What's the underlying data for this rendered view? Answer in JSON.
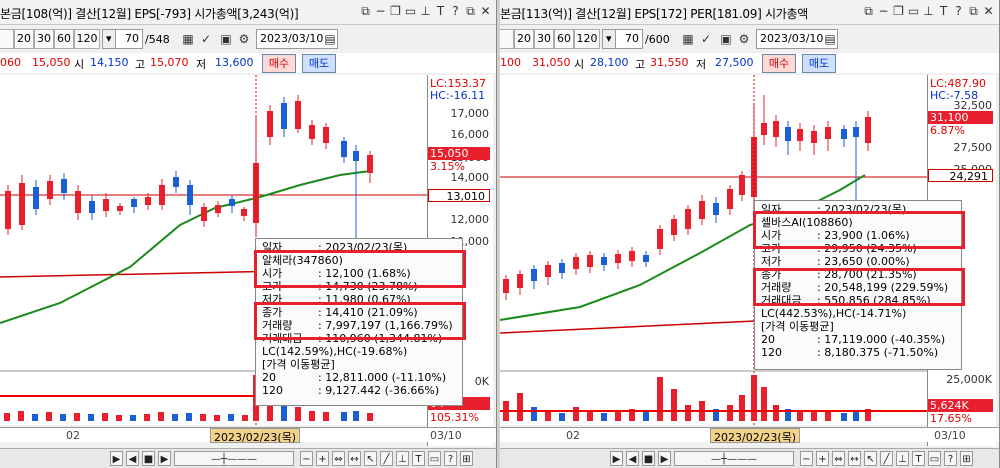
{
  "colors": {
    "up": "#e8202e",
    "down": "#1b5fd6",
    "ma": "#1a8a1a",
    "line": "#cc0000",
    "highlight": "#e8202e"
  },
  "left": {
    "title": "본금[108(억)] 결산[12월] EPS[-793] 시가총액[3,243(억)]",
    "title_icons": [
      "restore-icon",
      "unpin-icon",
      "copy-icon",
      "minimize-icon",
      "pin-icon",
      "text-icon",
      "help-icon",
      "restore-icon",
      "close-icon"
    ],
    "period_buttons": [
      "20",
      "30",
      "60",
      "120"
    ],
    "count_value": "70",
    "count_total": "/548",
    "date_value": "2023/03/10",
    "prev_close": "060",
    "current": "15,050",
    "open_label": "시",
    "open": "14,150",
    "high_label": "고",
    "high": "15,070",
    "low_label": "저",
    "low": "13,600",
    "buy": "매수",
    "sell": "매도",
    "axis": {
      "lc": "LC:153.37",
      "hc": "HC:-16.11",
      "ticks": [
        "17,000",
        "16,000",
        "15,000",
        "14,000",
        "13,000",
        "12,000",
        "11,000"
      ],
      "price_flag": "15,050",
      "pct_flag": "3.15%",
      "line_flag": "13,010",
      "vol_tick": "0K",
      "vol_flag": "04",
      "vol_pct": "105.31%"
    },
    "dates": {
      "d1": "02",
      "highlight": "2023/02/23(목)",
      "end": "03/10"
    },
    "tooltip": {
      "date_label": "일자",
      "date_value": ": 2023/02/23(목)",
      "name": "알체라(347860)",
      "rows": [
        {
          "k": "시가",
          "v": ": 12,100 (1.68%)"
        },
        {
          "k": "고가",
          "v": ": 14,730 (23.78%)"
        },
        {
          "k": "저가",
          "v": ": 11,980 (0.67%)"
        },
        {
          "k": "종가",
          "v": ": 14,410 (21.09%)"
        },
        {
          "k": "거래량",
          "v": ": 7,997,197 (1,166.79%)"
        },
        {
          "k": "거래대금",
          "v": ": 110,960 (1,344.81%)"
        }
      ],
      "lc_hc": "LC(142.59%),HC(-19.68%)",
      "ma_header": "[가격 이동평균]",
      "ma_rows": [
        {
          "k": "20",
          "v": ": 12,811.000 (-11.10%)"
        },
        {
          "k": "120",
          "v": ": 9,127.442 (-36.66%)"
        }
      ]
    }
  },
  "right": {
    "title": "본금[113(억)] 결산[12월] EPS[172] PER[181.09] 시가총액",
    "title_icons": [
      "restore-icon",
      "unpin-icon",
      "copy-icon",
      "minimize-icon",
      "pin-icon",
      "text-icon",
      "help-icon",
      "restore-icon",
      "close-icon"
    ],
    "period_buttons": [
      "20",
      "30",
      "60",
      "120"
    ],
    "count_value": "70",
    "count_total": "/600",
    "date_value": "2023/03/10",
    "prev_close": "100",
    "current": "31,050",
    "open_label": "시",
    "open": "28,100",
    "high_label": "고",
    "high": "31,550",
    "low_label": "저",
    "low": "27,500",
    "buy": "매수",
    "sell": "매도",
    "axis": {
      "lc": "LC:487.90",
      "hc": "HC:-7.58",
      "ticks": [
        "32,500",
        "30,000",
        "27,500",
        "25,000"
      ],
      "price_flag": "31,100",
      "pct_flag": "6.87%",
      "line_flag": "24,291",
      "vol_tick": "25,000K",
      "vol_flag": "5,624K",
      "vol_pct": "17.65%"
    },
    "dates": {
      "d1": "02",
      "highlight": "2023/02/23(목)",
      "end": "03/10"
    },
    "tooltip": {
      "date_label": "일자",
      "date_value": ": 2023/02/23(목)",
      "name": "셀바스AI(108860)",
      "rows": [
        {
          "k": "시가",
          "v": ": 23,900 (1.06%)"
        },
        {
          "k": "고가",
          "v": ": 29,950 (24.35%)"
        },
        {
          "k": "저가",
          "v": ": 23,650 (0.00%)"
        },
        {
          "k": "종가",
          "v": ": 28,700 (21.35%)"
        },
        {
          "k": "거래량",
          "v": ": 20,548,199 (229.59%)"
        },
        {
          "k": "거래대금",
          "v": ": 550,856 (284.85%)"
        }
      ],
      "lc_hc": "LC(442.53%),HC(-14.71%)",
      "ma_header": "[가격 이동평균]",
      "ma_rows": [
        {
          "k": "20",
          "v": ": 17,119.000 (-40.35%)"
        },
        {
          "k": "120",
          "v": ": 8,180.375 (-71.50%)"
        }
      ]
    }
  }
}
